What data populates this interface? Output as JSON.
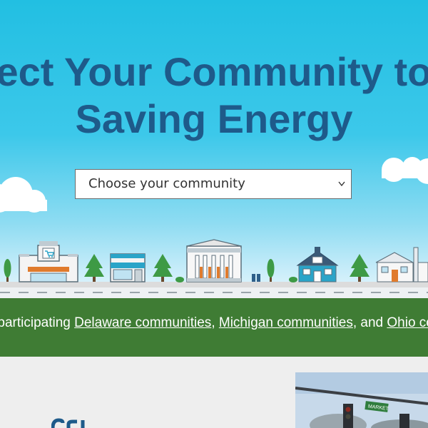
{
  "hero": {
    "headline_line1": "Connect Your Community to Start",
    "headline_line2": "Saving Energy",
    "select": {
      "placeholder": "Choose your community",
      "icon": "chevron-down-icon"
    }
  },
  "banner": {
    "prefix": "All participating ",
    "link1": "Delaware communities",
    "sep1": ", ",
    "link2": "Michigan communities",
    "sep2": ", and ",
    "link3": "Ohio communities"
  },
  "photo": {
    "street_sign": "MARKET"
  },
  "colors": {
    "sky": "#22bfe2",
    "headline": "#1e5a8a",
    "banner": "#3f7c34",
    "page_bg": "#eeeeee"
  }
}
